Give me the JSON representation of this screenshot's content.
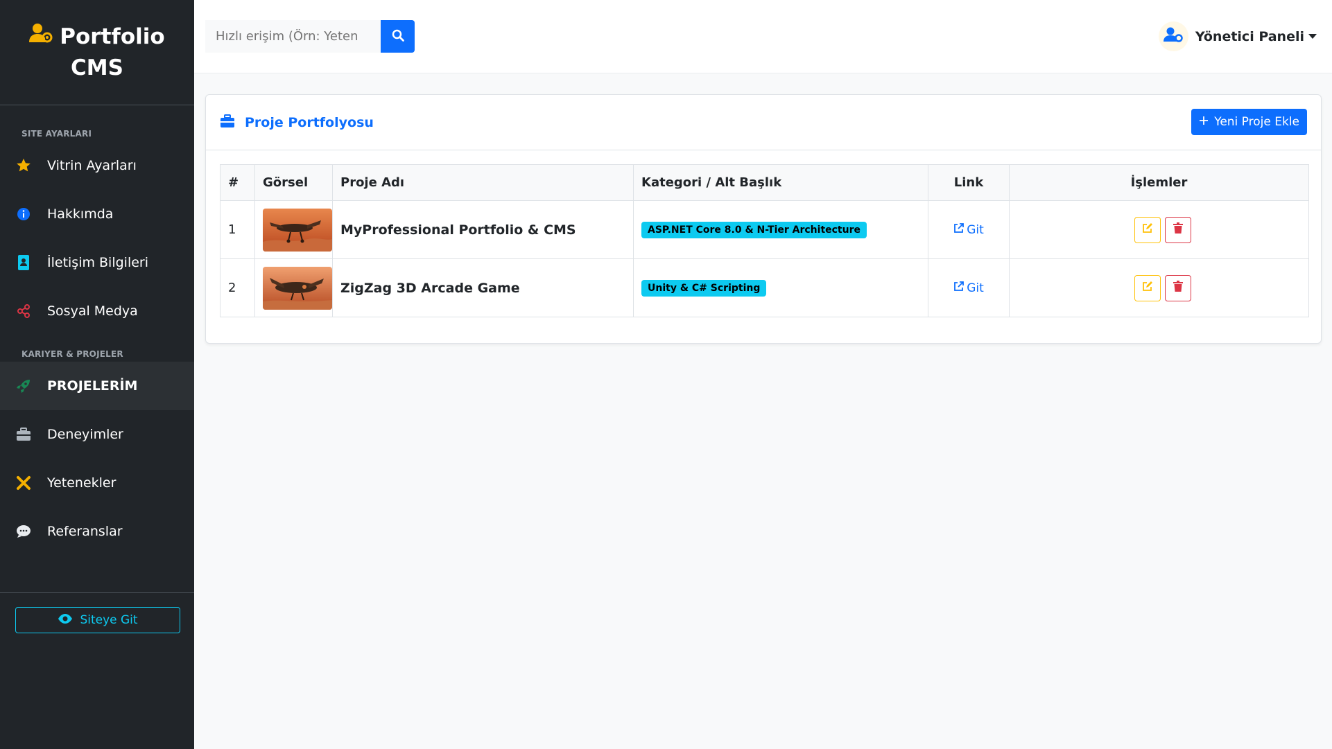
{
  "brand": {
    "line1": "Portfolio",
    "line2": "CMS"
  },
  "sidebar": {
    "sections": [
      {
        "title": "SITE AYARLARI",
        "items": [
          {
            "label": "Vitrin Ayarları",
            "icon": "star-icon"
          },
          {
            "label": "Hakkımda",
            "icon": "info-icon"
          },
          {
            "label": "İletişim Bilgileri",
            "icon": "address-book-icon"
          },
          {
            "label": "Sosyal Medya",
            "icon": "share-icon"
          }
        ]
      },
      {
        "title": "KARIYER & PROJELER",
        "items": [
          {
            "label": "PROJELERİM",
            "icon": "rocket-icon"
          },
          {
            "label": "Deneyimler",
            "icon": "briefcase-icon"
          },
          {
            "label": "Yetenekler",
            "icon": "tools-icon"
          },
          {
            "label": "Referanslar",
            "icon": "comment-icon"
          }
        ]
      }
    ],
    "site_button": "Siteye Git"
  },
  "search": {
    "placeholder": "Hızlı erişim (Örn: Yeten"
  },
  "user": {
    "label": "Yönetici Paneli"
  },
  "card": {
    "title": "Proje Portfolyosu",
    "add_button": "Yeni Proje Ekle"
  },
  "table": {
    "headers": [
      "#",
      "Görsel",
      "Proje Adı",
      "Kategori / Alt Başlık",
      "Link",
      "İşlemler"
    ],
    "rows": [
      {
        "num": "1",
        "name": "MyProfessional Portfolio & CMS",
        "category": "ASP.NET Core 8.0 & N-Tier Architecture",
        "link": "Git"
      },
      {
        "num": "2",
        "name": "ZigZag 3D Arcade Game",
        "category": "Unity & C# Scripting",
        "link": "Git"
      }
    ]
  },
  "colors": {
    "sidebar": "#212529",
    "primary": "#0d6efd",
    "info": "#0dcaf0",
    "warning": "#ffc107",
    "danger": "#dc3545",
    "accent": "#f5b000"
  }
}
